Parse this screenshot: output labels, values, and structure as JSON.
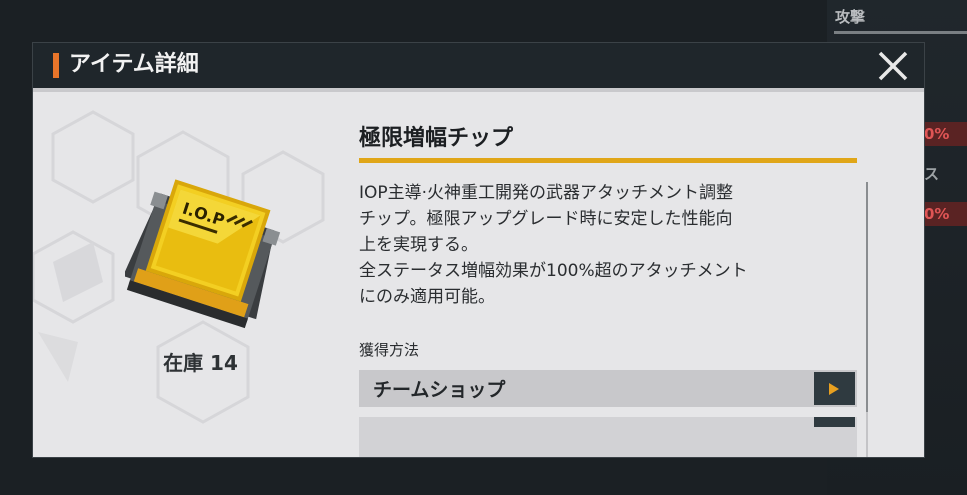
{
  "background": {
    "label_top": "攻撃",
    "value_1": "0%",
    "label_mid": "ス",
    "value_2": "0%"
  },
  "dialog": {
    "title": "アイテム詳細",
    "close_icon": "close-icon"
  },
  "item": {
    "name": "極限増幅チップ",
    "image_icon": "chip-icon",
    "image_text": "I.O.P",
    "stock_label": "在庫 14",
    "description": "IOP主導·火神重工開発の武器アタッチメント調整\nチップ。極限アップグレード時に安定した性能向\n上を実現する。\n全ステータス増幅効果が100%超のアタッチメント\nにのみ適用可能。"
  },
  "acquisition": {
    "label": "獲得方法",
    "sources": [
      {
        "label": "チームショップ",
        "icon": "play-arrow-icon"
      }
    ]
  },
  "colors": {
    "accent_orange": "#e8752a",
    "underline_gold": "#e0a618",
    "header_dark": "#1f262b"
  }
}
